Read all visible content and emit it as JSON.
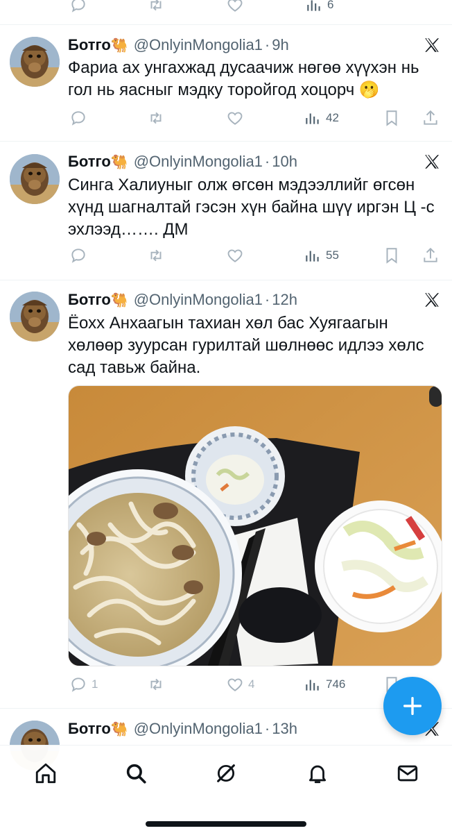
{
  "previous_post_actions": {
    "views": "6"
  },
  "posts": [
    {
      "name": "Ботго",
      "camel_emoji": "🐫",
      "handle": "@OnlyinMongolia1",
      "separator": "·",
      "time": "9h",
      "text": "Фариа ах унгахжад дусаачиж нөгөө хүүхэн нь гол нь яасныг мэдку торойгод хоцорч 🫢",
      "replies": "",
      "reposts": "",
      "likes": "",
      "views": "42"
    },
    {
      "name": "Ботго",
      "camel_emoji": "🐫",
      "handle": "@OnlyinMongolia1",
      "separator": "·",
      "time": "10h",
      "text": "Синга Халиуныг олж өгсөн мэдээллийг өгсөн хүнд шагналтай гэсэн хүн байна шүү иргэн Ц -с эхлээд……. ДМ",
      "replies": "",
      "reposts": "",
      "likes": "",
      "views": "55"
    },
    {
      "name": "Ботго",
      "camel_emoji": "🐫",
      "handle": "@OnlyinMongolia1",
      "separator": "·",
      "time": "12h",
      "text": "Ёохх Анхаагын тахиан хөл бас Хуягаагын хөлөөр зуурсан гурилтай шөлнөөс идлээ хөлс сад тавьж байна.",
      "replies": "1",
      "reposts": "",
      "likes": "4",
      "views": "746"
    },
    {
      "name": "Ботго",
      "camel_emoji": "🐫",
      "handle": "@OnlyinMongolia1",
      "separator": "·",
      "time": "13h"
    }
  ],
  "icons": {
    "reply": "reply-icon",
    "repost": "repost-icon",
    "like": "heart-icon",
    "views": "views-bar-chart-icon",
    "bookmark": "bookmark-icon",
    "share": "share-icon",
    "x_logo": "x-logo-icon",
    "compose": "plus-icon"
  },
  "bottom_nav": [
    "home-icon",
    "search-icon",
    "grok-icon",
    "bell-icon",
    "mail-icon"
  ],
  "colors": {
    "accent": "#1d9bf0",
    "text": "#0f1419",
    "muted": "#536471",
    "icon_gray": "#a7b3bd",
    "divider": "#eff3f4"
  }
}
